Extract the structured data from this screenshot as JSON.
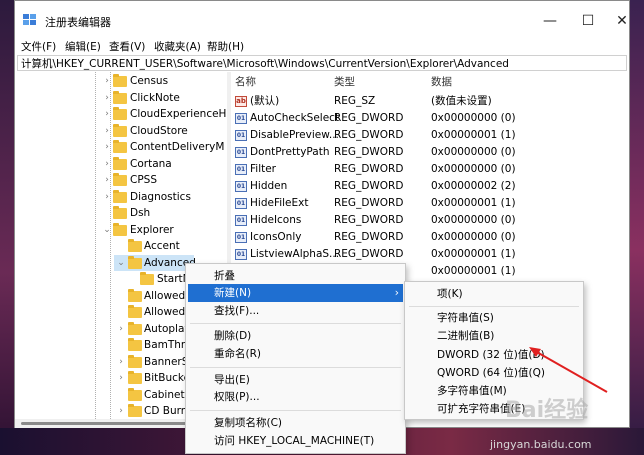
{
  "window": {
    "title": "注册表编辑器",
    "minimize": "—",
    "maximize": "☐",
    "close": "✕"
  },
  "menu": [
    "文件(F)",
    "编辑(E)",
    "查看(V)",
    "收藏夹(A)",
    "帮助(H)"
  ],
  "address": "计算机\\HKEY_CURRENT_USER\\Software\\Microsoft\\Windows\\CurrentVersion\\Explorer\\Advanced",
  "tree": {
    "items": [
      "Census",
      "ClickNote",
      "CloudExperienceH",
      "CloudStore",
      "ContentDeliveryM",
      "Cortana",
      "CPSS",
      "Diagnostics",
      "Dsh",
      "Explorer",
      "Accent",
      "Advanced",
      "StartM",
      "AllowedE",
      "AllowedE",
      "Autoplay",
      "BamThro",
      "BannerSt",
      "BitBucke",
      "CabinetS",
      "CD Burni"
    ]
  },
  "list": {
    "headers": [
      "名称",
      "类型",
      "数据"
    ],
    "rows": [
      {
        "name": "(默认)",
        "type": "REG_SZ",
        "data": "(数值未设置)",
        "icon": "ab"
      },
      {
        "name": "AutoCheckSelect",
        "type": "REG_DWORD",
        "data": "0x00000000 (0)",
        "icon": "dword"
      },
      {
        "name": "DisablePreview...",
        "type": "REG_DWORD",
        "data": "0x00000001 (1)",
        "icon": "dword"
      },
      {
        "name": "DontPrettyPath",
        "type": "REG_DWORD",
        "data": "0x00000000 (0)",
        "icon": "dword"
      },
      {
        "name": "Filter",
        "type": "REG_DWORD",
        "data": "0x00000000 (0)",
        "icon": "dword"
      },
      {
        "name": "Hidden",
        "type": "REG_DWORD",
        "data": "0x00000002 (2)",
        "icon": "dword"
      },
      {
        "name": "HideFileExt",
        "type": "REG_DWORD",
        "data": "0x00000001 (1)",
        "icon": "dword"
      },
      {
        "name": "HideIcons",
        "type": "REG_DWORD",
        "data": "0x00000000 (0)",
        "icon": "dword"
      },
      {
        "name": "IconsOnly",
        "type": "REG_DWORD",
        "data": "0x00000000 (0)",
        "icon": "dword"
      },
      {
        "name": "ListviewAlphaS...",
        "type": "REG_DWORD",
        "data": "0x00000001 (1)",
        "icon": "dword"
      },
      {
        "name": "",
        "type": "",
        "data": "0x00000001 (1)",
        "icon": ""
      }
    ]
  },
  "context_menu": {
    "items": [
      "折叠",
      "新建(N)",
      "查找(F)...",
      "删除(D)",
      "重命名(R)",
      "导出(E)",
      "权限(P)...",
      "复制项名称(C)",
      "访问 HKEY_LOCAL_MACHINE(T)"
    ],
    "submenu_arrow": "›"
  },
  "submenu": {
    "items": [
      "项(K)",
      "字符串值(S)",
      "二进制值(B)",
      "DWORD (32 位)值(D)",
      "QWORD (64 位)值(Q)",
      "多字符串值(M)",
      "可扩充字符串值(E)"
    ]
  },
  "watermark": {
    "text": "jingyan.baidu.com",
    "logo": "Bai经验"
  },
  "colors": {
    "highlight": "#1f6fd1",
    "selection": "#cce4f7",
    "folder": "#f4c542",
    "arrow": "#e02020"
  }
}
